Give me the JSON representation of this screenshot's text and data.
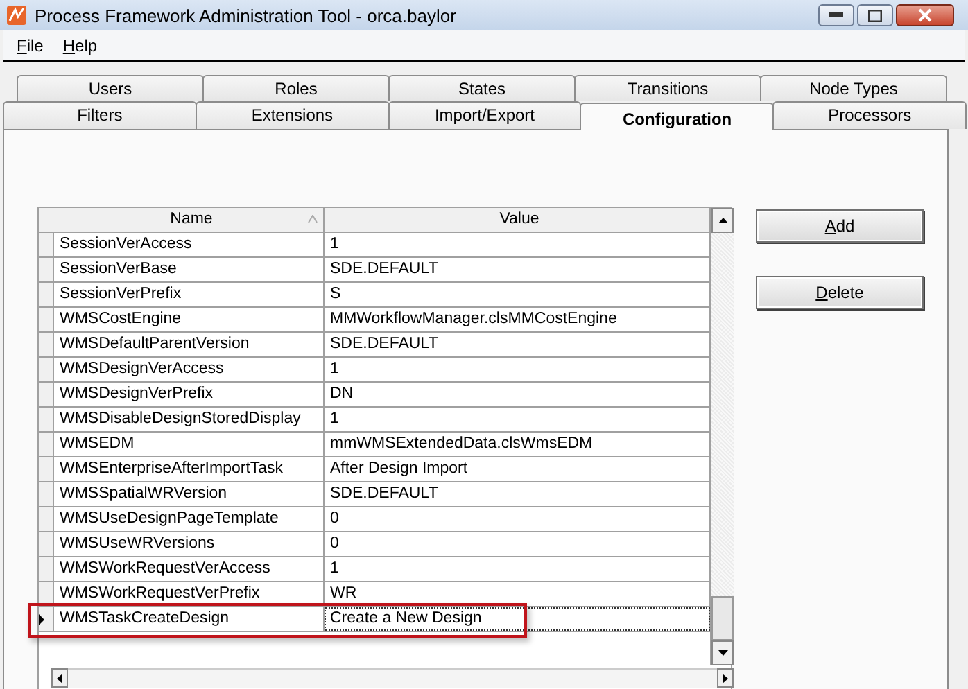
{
  "window": {
    "title": "Process Framework Administration Tool - orca.baylor"
  },
  "menu": [
    "File",
    "Help"
  ],
  "tab_rows": [
    [
      {
        "label": "Users",
        "selected": false
      },
      {
        "label": "Roles",
        "selected": false
      },
      {
        "label": "States",
        "selected": false
      },
      {
        "label": "Transitions",
        "selected": false
      },
      {
        "label": "Node Types",
        "selected": false
      }
    ],
    [
      {
        "label": "Filters",
        "selected": false
      },
      {
        "label": "Extensions",
        "selected": false
      },
      {
        "label": "Import/Export",
        "selected": false
      },
      {
        "label": "Configuration",
        "selected": true
      },
      {
        "label": "Processors",
        "selected": false
      }
    ]
  ],
  "table": {
    "columns": [
      "Name",
      "Value"
    ],
    "rows": [
      {
        "name": "SessionVerAccess",
        "value": "1",
        "selected": false
      },
      {
        "name": "SessionVerBase",
        "value": "SDE.DEFAULT",
        "selected": false
      },
      {
        "name": "SessionVerPrefix",
        "value": "S",
        "selected": false
      },
      {
        "name": "WMSCostEngine",
        "value": "MMWorkflowManager.clsMMCostEngine",
        "selected": false
      },
      {
        "name": "WMSDefaultParentVersion",
        "value": "SDE.DEFAULT",
        "selected": false
      },
      {
        "name": "WMSDesignVerAccess",
        "value": "1",
        "selected": false
      },
      {
        "name": "WMSDesignVerPrefix",
        "value": "DN",
        "selected": false
      },
      {
        "name": "WMSDisableDesignStoredDisplay",
        "value": "1",
        "selected": false
      },
      {
        "name": "WMSEDM",
        "value": "mmWMSExtendedData.clsWmsEDM",
        "selected": false
      },
      {
        "name": "WMSEnterpriseAfterImportTask",
        "value": "After Design Import",
        "selected": false
      },
      {
        "name": "WMSSpatialWRVersion",
        "value": "SDE.DEFAULT",
        "selected": false
      },
      {
        "name": "WMSUseDesignPageTemplate",
        "value": "0",
        "selected": false
      },
      {
        "name": "WMSUseWRVersions",
        "value": "0",
        "selected": false
      },
      {
        "name": "WMSWorkRequestVerAccess",
        "value": "1",
        "selected": false
      },
      {
        "name": "WMSWorkRequestVerPrefix",
        "value": "WR",
        "selected": false
      },
      {
        "name": "WMSTaskCreateDesign",
        "value": "Create a New Design",
        "selected": true
      }
    ]
  },
  "buttons": [
    "Add",
    "Delete"
  ]
}
